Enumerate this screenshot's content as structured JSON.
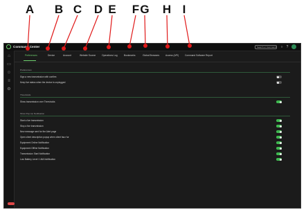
{
  "annotations": [
    "A",
    "B",
    "C",
    "D",
    "E",
    "F",
    "G",
    "H",
    "I"
  ],
  "app": {
    "title": "Command Center",
    "search_placeholder": "Search or Command"
  },
  "tabs": [
    {
      "label": "Preferences",
      "active": true
    },
    {
      "label": "Device",
      "active": false
    },
    {
      "label": "Account",
      "active": false
    },
    {
      "label": "Website Source",
      "active": false
    },
    {
      "label": "Operations Log",
      "active": false
    },
    {
      "label": "Bookmarks",
      "active": false
    },
    {
      "label": "Global Browsers",
      "active": false
    },
    {
      "label": "Access (API)",
      "active": false
    },
    {
      "label": "Command Software Report",
      "active": false
    }
  ],
  "sections": [
    {
      "title": "Preferences",
      "rows": [
        {
          "label": "Sign a new transmission with confirm",
          "on": false
        },
        {
          "label": "Keep live status when the device is unplugged",
          "on": false
        }
      ]
    },
    {
      "title": "Thresholds",
      "rows": [
        {
          "label": "Show transmission over Thresholds",
          "on": true
        }
      ]
    },
    {
      "title": "Show Pop-Up Notification",
      "rows": [
        {
          "label": "Start a live transmission",
          "on": true
        },
        {
          "label": "Stop a live transmission",
          "on": true
        },
        {
          "label": "New message sent for the Alert page",
          "on": true
        },
        {
          "label": "Open client description popup when client faux fur",
          "on": true
        },
        {
          "label": "Equipment Online Notification",
          "on": true
        },
        {
          "label": "Equipment Offline Notification",
          "on": true
        },
        {
          "label": "Transmission Start Notification",
          "on": true
        },
        {
          "label": "Low Battery Level / LMA Notification",
          "on": true
        }
      ]
    }
  ],
  "colors": {
    "accent": "#6fd06f",
    "toggle_on": "#3fb950",
    "marker": "#e01818"
  }
}
